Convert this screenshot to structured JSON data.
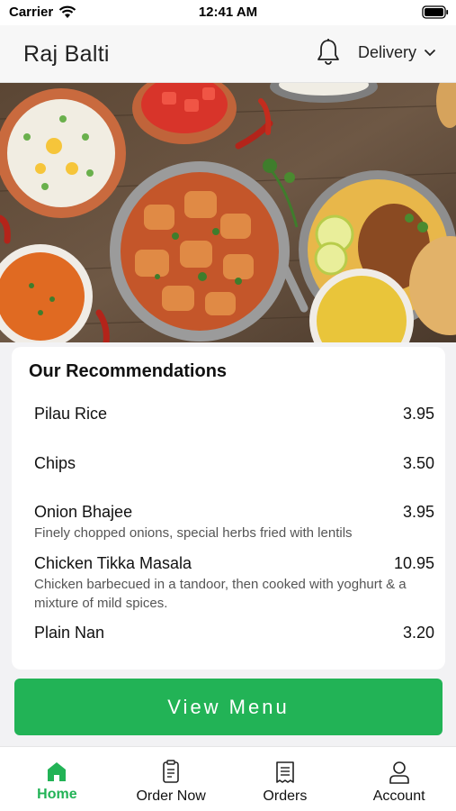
{
  "status_bar": {
    "carrier": "Carrier",
    "time": "12:41 AM"
  },
  "header": {
    "title": "Raj Balti",
    "delivery_mode": "Delivery"
  },
  "recommendations": {
    "title": "Our Recommendations",
    "items": [
      {
        "name": "Pilau Rice",
        "price": "3.95",
        "description": ""
      },
      {
        "name": "Chips",
        "price": "3.50",
        "description": ""
      },
      {
        "name": "Onion Bhajee",
        "price": "3.95",
        "description": "Finely chopped onions, special herbs fried with lentils"
      },
      {
        "name": "Chicken Tikka Masala",
        "price": "10.95",
        "description": "Chicken barbecued in a tandoor, then cooked with yoghurt & a mixture of mild spices."
      },
      {
        "name": "Plain Nan",
        "price": "3.20",
        "description": ""
      }
    ]
  },
  "view_menu_label": "View Menu",
  "tabs": [
    {
      "label": "Home",
      "icon": "home-icon",
      "active": true
    },
    {
      "label": "Order Now",
      "icon": "order-icon",
      "active": false
    },
    {
      "label": "Orders",
      "icon": "receipt-icon",
      "active": false
    },
    {
      "label": "Account",
      "icon": "user-icon",
      "active": false
    }
  ],
  "colors": {
    "accent": "#22b356",
    "text": "#111111",
    "muted": "#555555"
  }
}
